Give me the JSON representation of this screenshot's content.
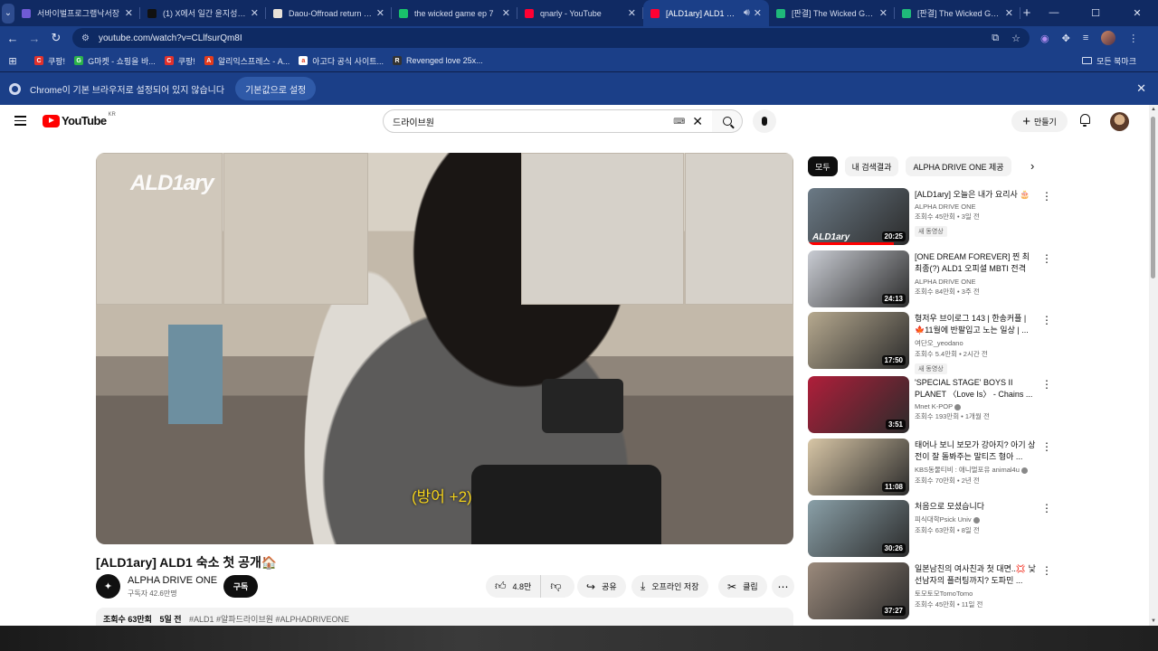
{
  "tabs": [
    {
      "title": "서바이벌프로그램낙서장",
      "color": "#6f5bd6",
      "active": false
    },
    {
      "title": "(1) X에서 일간 윤지성 님",
      "color": "#111111",
      "active": false
    },
    {
      "title": "Daou-Offroad return for",
      "color": "#e9e2d8",
      "active": false
    },
    {
      "title": "the wicked game ep 7",
      "color": "#19c26b",
      "active": false
    },
    {
      "title": "qnarly - YouTube",
      "color": "#ff0033",
      "active": false
    },
    {
      "title": "[ALD1ary] ALD1 숙소",
      "color": "#ff0033",
      "active": true
    },
    {
      "title": "[판결] The Wicked Game",
      "color": "#1fb97a",
      "active": false
    },
    {
      "title": "[판결] The Wicked Game",
      "color": "#1fb97a",
      "active": false
    }
  ],
  "toolbar": {
    "url": "youtube.com/watch?v=CLlfsurQm8I"
  },
  "bookmarks": [
    {
      "label": "쿠팡!",
      "icon": "C",
      "color": "#e2312b"
    },
    {
      "label": "G마켓 - 쇼핑을 바...",
      "icon": "G",
      "color": "#2bb34a"
    },
    {
      "label": "쿠팡!",
      "icon": "C",
      "color": "#e2312b"
    },
    {
      "label": "알리익스프레스 - A...",
      "icon": "A",
      "color": "#e43b1c"
    },
    {
      "label": "아고다 공식 사이트...",
      "icon": "a",
      "color": "#ffffff"
    },
    {
      "label": "Revenged love 25x...",
      "icon": "R",
      "color": "#333333"
    }
  ],
  "bookmarks_folder": "모든 북마크",
  "infobar": {
    "message": "Chrome이 기본 브라우저로 설정되어 있지 않습니다",
    "button": "기본값으로 설정"
  },
  "youtube": {
    "logo": "YouTube",
    "region": "KR",
    "search_value": "드라이브원",
    "create_label": "만들기"
  },
  "video": {
    "overlay_brand": "ALD1ary",
    "subtitle": "(방어 +2)",
    "title": "[ALD1ary] ALD1 숙소 첫 공개🏠",
    "channel": "ALPHA DRIVE ONE",
    "subscribers": "구독자 42.6만명",
    "subscribe_label": "구독",
    "likes": "4.8만",
    "share_label": "공유",
    "download_label": "오프라인 저장",
    "clip_label": "클립",
    "views": "조회수 63만회",
    "date": "5일 전",
    "tags": "#ALD1 #알파드라이브원 #ALPHADRIVEONE"
  },
  "chips": [
    "모두",
    "내 검색결과",
    "ALPHA DRIVE ONE 제공"
  ],
  "recommendations": [
    {
      "title": "[ALD1ary] 오늘은 내가 요리사 🎂",
      "channel": "ALPHA DRIVE ONE",
      "meta": "조회수 45만회 • 3일 전",
      "duration": "20:25",
      "badge": "새 동영상",
      "watermark": "ALD1ary",
      "progress": 0.85,
      "verified": false,
      "thumb_color": "#6b7a86"
    },
    {
      "title": "[ONE DREAM FOREVER] 찐 최최종(?) ALD1 오피셜 MBTI 전격 공...",
      "channel": "ALPHA DRIVE ONE",
      "meta": "조회수 84만회 • 3주 전",
      "duration": "24:13",
      "badge": "",
      "watermark": "",
      "progress": 0,
      "verified": false,
      "thumb_color": "#c9ccd3"
    },
    {
      "title": "형저우 브이로그 143 | 한송커플 | 🍁11월에 반팔입고 노는 일상 | ...",
      "channel": "여단오_yeodano",
      "meta": "조회수 5.4만회 • 2시간 전",
      "duration": "17:50",
      "badge": "새 동영상",
      "watermark": "",
      "progress": 0,
      "verified": false,
      "thumb_color": "#b6a98f"
    },
    {
      "title": "'SPECIAL STAGE' BOYS II PLANET 〈Love Is〉 - Chains ...",
      "channel": "Mnet K-POP",
      "meta": "조회수 193만회 • 1개월 전",
      "duration": "3:51",
      "badge": "",
      "watermark": "",
      "progress": 0,
      "verified": true,
      "thumb_color": "#b01e3a"
    },
    {
      "title": "태어나 보니 보모가 강아지? 아기 상전이 잘 돌봐주는 말티즈 형아 ...",
      "channel": "KBS동물티비 : 애니멀포유 animal4u",
      "meta": "조회수 70만회 • 2년 전",
      "duration": "11:08",
      "badge": "",
      "watermark": "",
      "progress": 0,
      "verified": true,
      "thumb_color": "#d8c6a6"
    },
    {
      "title": "처음으로 모셨습니다",
      "channel": "피식대학Psick Univ",
      "meta": "조회수 63만회 • 8일 전",
      "duration": "30:26",
      "badge": "",
      "watermark": "",
      "progress": 0,
      "verified": true,
      "thumb_color": "#8aa0a8"
    },
    {
      "title": "일본남친의 여사친과 첫 대면..💢 낯선남자의 플러팅까지? 도파민 ...",
      "channel": "토모토모TomoTomo",
      "meta": "조회수 45만회 • 11일 전",
      "duration": "37:27",
      "badge": "",
      "watermark": "",
      "progress": 0,
      "verified": false,
      "thumb_color": "#9b8a7c"
    }
  ]
}
